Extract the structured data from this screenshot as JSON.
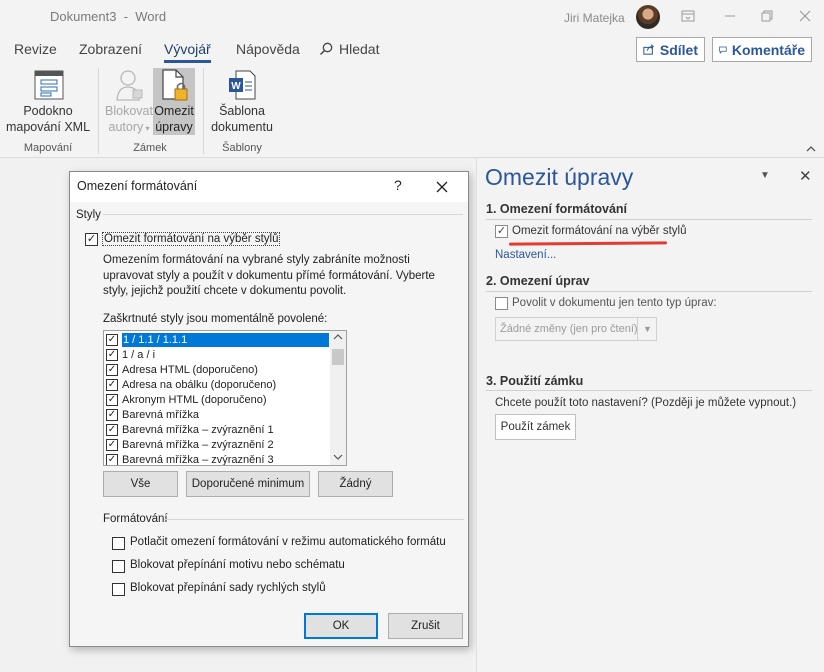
{
  "titlebar": {
    "doc_title": "Dokument3  -  Word",
    "user_name": "Jiri Matejka"
  },
  "tabs": {
    "items": [
      "Revize",
      "Zobrazení",
      "Vývojář",
      "Nápověda",
      "Hledat"
    ],
    "active": "Vývojář"
  },
  "share_button": "Sdílet",
  "comments_button": "Komentáře",
  "ribbon": {
    "groups": {
      "mapovani": "Mapování",
      "zamek": "Zámek",
      "sablony": "Šablony"
    },
    "buttons": {
      "podokno": [
        "Podokno",
        "mapování XML"
      ],
      "blokovat": [
        "Blokovat",
        "autory"
      ],
      "omezit": [
        "Omezit",
        "úpravy"
      ],
      "sablona": [
        "Šablona",
        "dokumentu"
      ]
    }
  },
  "dialog": {
    "title": "Omezení formátování",
    "help": "?",
    "section_styles": "Styly",
    "limit_checkbox": "Omezit formátování na výběr stylů",
    "description": "Omezením formátování na vybrané styly zabráníte možnosti upravovat styly a použít v dokumentu přímé formátování. Vyberte styly, jejichž použití chcete v dokumentu povolit.",
    "list_label": "Zaškrtnuté styly jsou momentálně povolené:",
    "styles": [
      "1 / 1.1 / 1.1.1",
      "1 / a / i",
      "Adresa HTML (doporučeno)",
      "Adresa na obálku (doporučeno)",
      "Akronym HTML (doporučeno)",
      "Barevná mřížka",
      "Barevná mřížka – zvýraznění 1",
      "Barevná mřížka – zvýraznění 2",
      "Barevná mřížka – zvýraznění 3"
    ],
    "btn_all": "Vše",
    "btn_recommended": "Doporučené minimum",
    "btn_none": "Žádný",
    "section_formatting": "Formátování",
    "options": [
      "Potlačit omezení formátování v režimu automatického formátu",
      "Blokovat přepínání motivu nebo schématu",
      "Blokovat přepínání sady rychlých stylů"
    ],
    "ok": "OK",
    "cancel": "Zrušit"
  },
  "pane": {
    "title": "Omezit úpravy",
    "s1_heading": "1. Omezení formátování",
    "s1_checkbox": "Omezit formátování na výběr stylů",
    "s1_link": "Nastavení...",
    "s2_heading": "2. Omezení úprav",
    "s2_checkbox": "Povolit v dokumentu jen tento typ úprav:",
    "s2_select": "Žádné změny (jen pro čtení)",
    "s3_heading": "3. Použití zámku",
    "s3_text": "Chcete použít toto nastavení? (Později je můžete vypnout.)",
    "s3_button": "Použít zámek"
  },
  "colors": {
    "accent": "#2b579a",
    "selection": "#0078d7",
    "annotation_underline": "#e03c31"
  }
}
